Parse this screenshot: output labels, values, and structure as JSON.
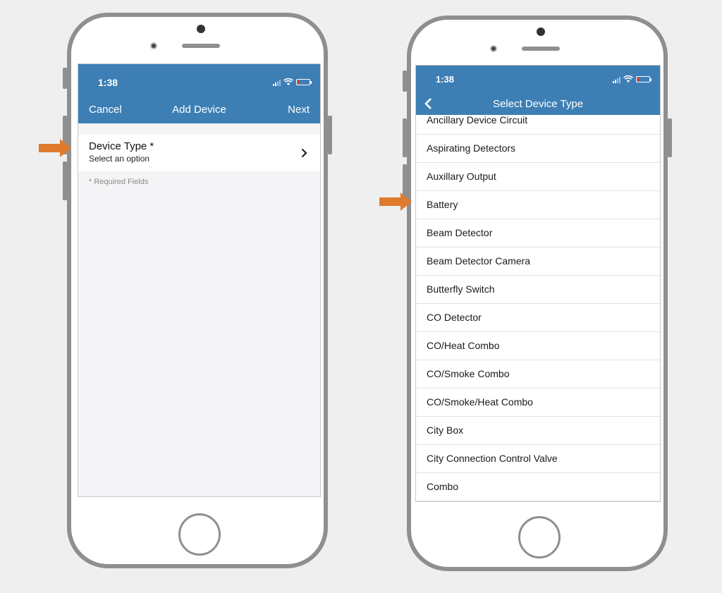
{
  "colors": {
    "navbar": "#3d7fb5",
    "arrow": "#e07a2c",
    "phone_frame": "#8f8f8f"
  },
  "left_phone": {
    "status_time": "1:38",
    "nav": {
      "cancel": "Cancel",
      "title": "Add Device",
      "next": "Next"
    },
    "field": {
      "label": "Device Type *",
      "value": "Select an option",
      "icon": "chevron-right-icon"
    },
    "required_note": "* Required Fields"
  },
  "right_phone": {
    "status_time": "1:38",
    "nav": {
      "back_icon": "chevron-left-icon",
      "title": "Select Device Type"
    },
    "items": [
      "Ancillary Device Circuit",
      "Aspirating Detectors",
      "Auxillary Output",
      "Battery",
      "Beam Detector",
      "Beam Detector Camera",
      "Butterfly Switch",
      "CO Detector",
      "CO/Heat Combo",
      "CO/Smoke Combo",
      "CO/Smoke/Heat Combo",
      "City Box",
      "City Connection Control Valve",
      "Combo"
    ]
  }
}
